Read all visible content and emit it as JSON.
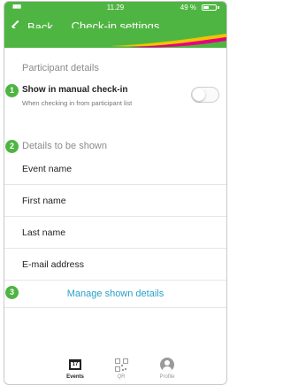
{
  "status_bar": {
    "signal": "▮▮▮▮",
    "time": "11.29",
    "battery_text": "49 %",
    "battery_level": 0.49
  },
  "header": {
    "back_label": "Back",
    "title": "Check-in settings"
  },
  "participant_details": {
    "badge": "1",
    "section_title": "Participant details",
    "manual_checkin_label": "Show in manual check-in",
    "manual_checkin_sub": "When checking in from participant list",
    "manual_checkin_on": false
  },
  "details_shown": {
    "badge": "2",
    "section_title": "Details to be shown",
    "items": [
      "Event name",
      "First name",
      "Last name",
      "E-mail address"
    ]
  },
  "manage": {
    "badge": "3",
    "label": "Manage shown details"
  },
  "tabbar": {
    "tabs": [
      {
        "label": "Events",
        "calendar_day": "17",
        "active": true
      },
      {
        "label": "QR",
        "active": false
      },
      {
        "label": "Profile",
        "active": false
      }
    ]
  },
  "colors": {
    "brand_green": "#4fb542",
    "link_blue": "#2aa0c6",
    "wave_yellow": "#f4c300",
    "wave_pink": "#e6007e"
  }
}
